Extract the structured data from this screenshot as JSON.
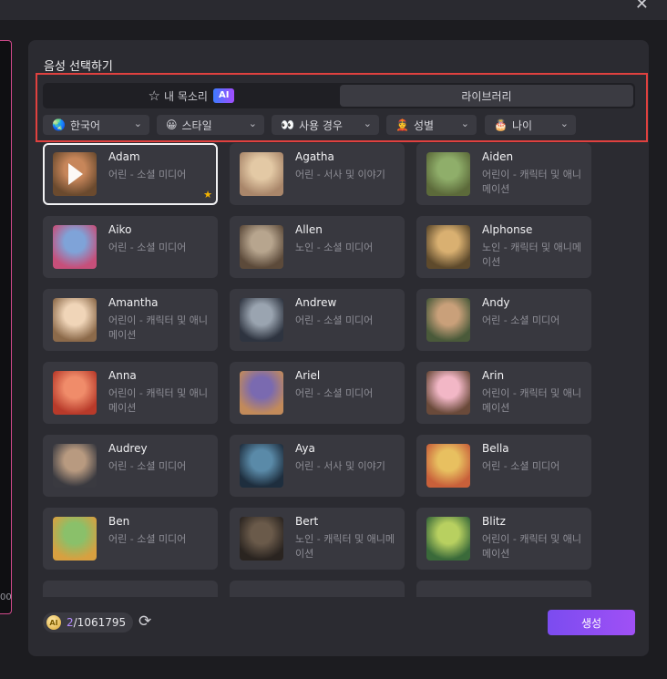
{
  "window": {
    "close_label": "✕"
  },
  "left_panel": {
    "edge_value": "00"
  },
  "dialog": {
    "title": "음성 선택하기",
    "tabs": [
      {
        "label": "내 목소리",
        "badge": "AI",
        "icon": "star-icon"
      },
      {
        "label": "라이브러리",
        "active": true
      }
    ],
    "filters": [
      {
        "icon": "globe",
        "emoji": "🌏",
        "label": "한국어"
      },
      {
        "icon": "smile",
        "emoji": "😀",
        "label": "스타일"
      },
      {
        "icon": "eyes",
        "emoji": "👀",
        "label": "사용 경우"
      },
      {
        "icon": "person",
        "emoji": "👲",
        "label": "성별"
      },
      {
        "icon": "cake",
        "emoji": "🎂",
        "label": "나이"
      }
    ],
    "voices": [
      {
        "name": "Adam",
        "desc": "어린 - 소셜 미디어",
        "selected": true,
        "favorite": true,
        "colors": [
          "#c7865a",
          "#6b4a2e"
        ]
      },
      {
        "name": "Agatha",
        "desc": "어린 - 서사 및 이야기",
        "colors": [
          "#e3c9a5",
          "#a9866a"
        ]
      },
      {
        "name": "Aiden",
        "desc": "어린이 - 캐릭터 및 애니메이션",
        "colors": [
          "#8fae6a",
          "#5c6a3a"
        ]
      },
      {
        "name": "Aiko",
        "desc": "어린 - 소셜 미디어",
        "colors": [
          "#7fa3d8",
          "#c64f7a"
        ]
      },
      {
        "name": "Allen",
        "desc": "노인 - 소셜 미디어",
        "colors": [
          "#b7a58e",
          "#5c4a3a"
        ]
      },
      {
        "name": "Alphonse",
        "desc": "노인 - 캐릭터 및 애니메이션",
        "colors": [
          "#d9b071",
          "#5e4a2c"
        ]
      },
      {
        "name": "Amantha",
        "desc": "어린이 - 캐릭터 및 애니메이션",
        "colors": [
          "#f0d5b8",
          "#8c6a4a"
        ]
      },
      {
        "name": "Andrew",
        "desc": "어린 - 소셜 미디어",
        "colors": [
          "#9aa4b0",
          "#2e3440"
        ]
      },
      {
        "name": "Andy",
        "desc": "어린 - 소셜 미디어",
        "colors": [
          "#c9a07a",
          "#4a5a3a"
        ]
      },
      {
        "name": "Anna",
        "desc": "어린이 - 캐릭터 및 애니메이션",
        "colors": [
          "#f08c6a",
          "#b83a2a"
        ]
      },
      {
        "name": "Ariel",
        "desc": "어린 - 소셜 미디어",
        "colors": [
          "#7a6ab0",
          "#c28a5a"
        ]
      },
      {
        "name": "Arin",
        "desc": "어린이 - 캐릭터 및 애니메이션",
        "colors": [
          "#f2b7c6",
          "#6a4a3a"
        ]
      },
      {
        "name": "Audrey",
        "desc": "어린 - 소셜 미디어",
        "colors": [
          "#b89a80",
          "#3a3a40"
        ]
      },
      {
        "name": "Aya",
        "desc": "어린 - 서사 및 이야기",
        "colors": [
          "#5a8aa8",
          "#1e2e3e"
        ]
      },
      {
        "name": "Bella",
        "desc": "어린 - 소셜 미디어",
        "colors": [
          "#e8c060",
          "#c8603a"
        ]
      },
      {
        "name": "Ben",
        "desc": "어린 - 소셜 미디어",
        "colors": [
          "#8ac06a",
          "#d8a040"
        ]
      },
      {
        "name": "Bert",
        "desc": "노인 - 캐릭터 및 애니메이션",
        "colors": [
          "#6a5a4a",
          "#2a2420"
        ]
      },
      {
        "name": "Blitz",
        "desc": "어린이 - 캐릭터 및 애니메이션",
        "colors": [
          "#b8d060",
          "#3a6a3a"
        ]
      }
    ],
    "credits": {
      "used": "2",
      "total": "/1061795",
      "coin_label": "AI"
    },
    "generate_label": "생성"
  }
}
